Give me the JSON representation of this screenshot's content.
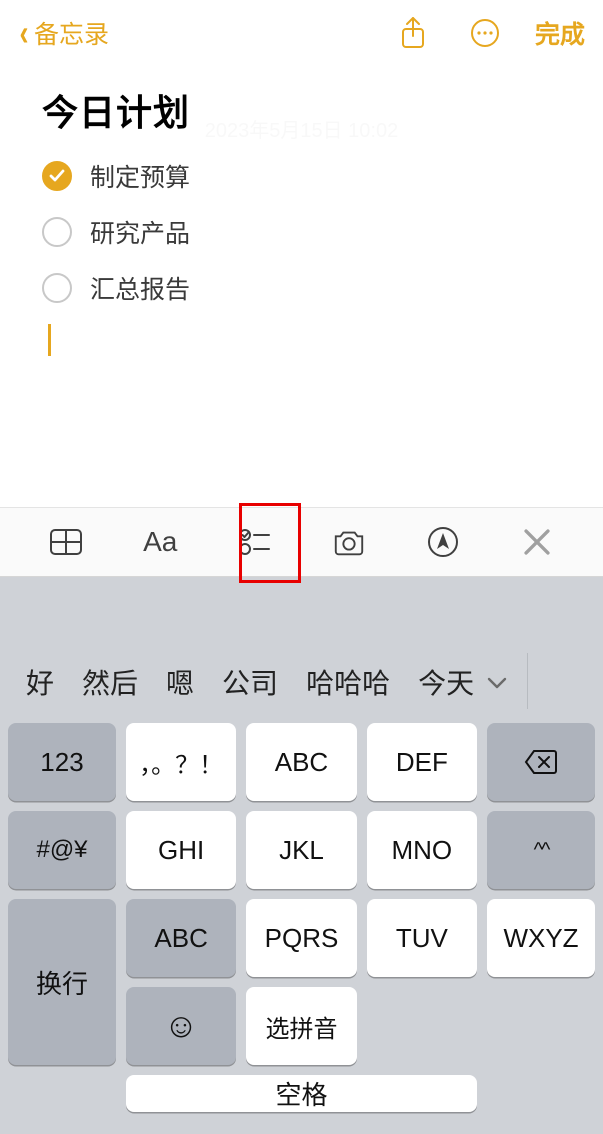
{
  "nav": {
    "back_label": "备忘录",
    "done_label": "完成"
  },
  "note": {
    "date_watermark": "2023年5月15日 10:02",
    "title": "今日计划",
    "items": [
      {
        "label": "制定预算",
        "checked": true
      },
      {
        "label": "研究产品",
        "checked": false
      },
      {
        "label": "汇总报告",
        "checked": false
      }
    ]
  },
  "format_bar": {
    "aa_label": "Aa"
  },
  "ime": {
    "candidates": [
      "好",
      "然后",
      "嗯",
      "公司",
      "哈哈哈",
      "今天"
    ]
  },
  "keyboard": {
    "row1": [
      "123",
      "，。？！",
      "ABC",
      "DEF"
    ],
    "row2": [
      "#@¥",
      "GHI",
      "JKL",
      "MNO",
      "^^"
    ],
    "row3": [
      "ABC",
      "PQRS",
      "TUV",
      "WXYZ"
    ],
    "enter": "换行",
    "row4": {
      "ime_select": "选拼音",
      "space": "空格"
    }
  }
}
